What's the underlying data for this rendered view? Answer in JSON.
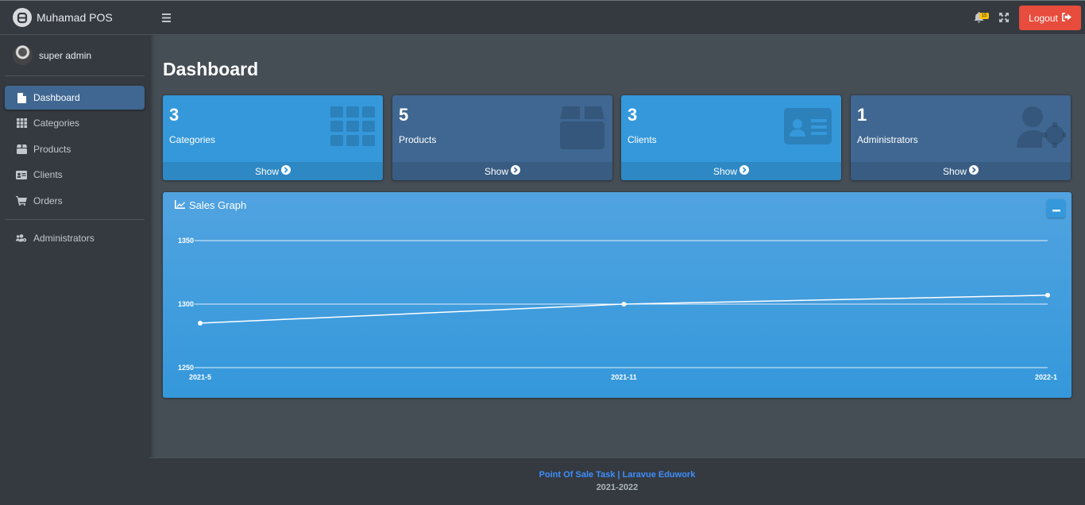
{
  "brand": {
    "name": "Muhamad POS"
  },
  "user": {
    "name": "super admin"
  },
  "sidebar": {
    "items": [
      {
        "label": "Dashboard",
        "icon": "file-icon",
        "active": true
      },
      {
        "label": "Categories",
        "icon": "grid-icon",
        "active": false
      },
      {
        "label": "Products",
        "icon": "box-icon",
        "active": false
      },
      {
        "label": "Clients",
        "icon": "id-card-icon",
        "active": false
      },
      {
        "label": "Orders",
        "icon": "cart-icon",
        "active": false
      }
    ],
    "admin_item": {
      "label": "Administrators",
      "icon": "users-cog-icon"
    }
  },
  "topbar": {
    "notification_count": "15",
    "logout_label": "Logout"
  },
  "page": {
    "title": "Dashboard"
  },
  "stats": [
    {
      "value": "3",
      "label": "Categories",
      "show_label": "Show",
      "color": "#3498db",
      "icon": "grid-icon"
    },
    {
      "value": "5",
      "label": "Products",
      "show_label": "Show",
      "color": "#3f6791",
      "icon": "box-icon"
    },
    {
      "value": "3",
      "label": "Clients",
      "show_label": "Show",
      "color": "#3498db",
      "icon": "id-card-icon"
    },
    {
      "value": "1",
      "label": "Administrators",
      "show_label": "Show",
      "color": "#3f6791",
      "icon": "user-cog-icon"
    }
  ],
  "graph": {
    "title": "Sales Graph"
  },
  "chart_data": {
    "type": "line",
    "x": [
      "2021-5",
      "2021-11",
      "2022-1"
    ],
    "series": [
      {
        "values": [
          1285,
          1300,
          1307
        ]
      }
    ],
    "yticks": [
      1250,
      1300,
      1350
    ],
    "ylim": [
      1250,
      1350
    ],
    "grid": true
  },
  "footer": {
    "link_text": "Point Of Sale Task | Laravue Eduwork",
    "year": "2021-2022"
  },
  "colors": {
    "accent_blue": "#3498db",
    "accent_navy": "#3f6791",
    "logout_red": "#e74c3c",
    "badge_yellow": "#ffc107",
    "footer_link": "#3f8efc"
  }
}
